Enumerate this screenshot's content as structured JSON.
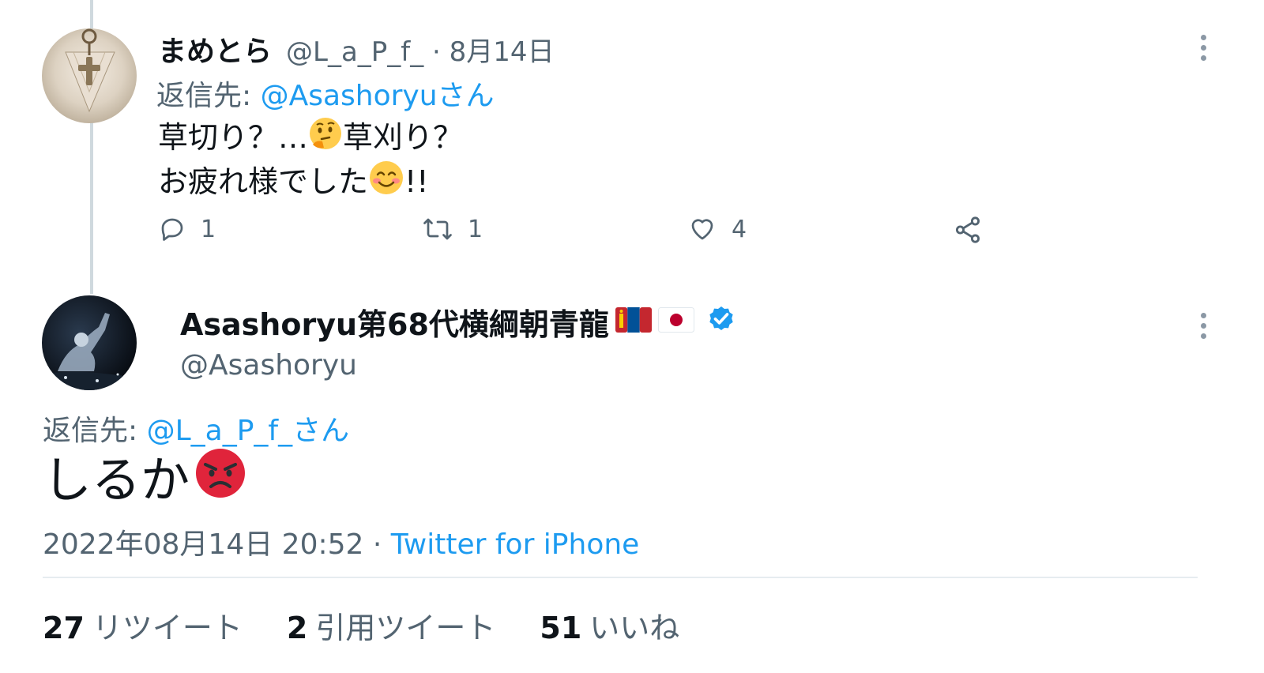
{
  "first_tweet": {
    "display_name": "まめとら",
    "meta": "@L_a_P_f_ · 8月14日",
    "reply_prefix": "返信先: ",
    "reply_mention": "@Asashoryuさん",
    "line1_a": "草切り？…",
    "line1_b": "草刈り？",
    "line2_a": "お疲れ様でした",
    "line2_b": "!!",
    "emoji_thinking": "thinking-face-emoji",
    "emoji_blush": "smiling-face-with-smiling-eyes-emoji",
    "actions": {
      "reply_count": "1",
      "retweet_count": "1",
      "like_count": "4"
    }
  },
  "main_tweet": {
    "display_name": "Asashoryu第68代横綱朝青龍",
    "flags": [
      "mongolia-flag",
      "japan-flag"
    ],
    "verified": true,
    "handle": "@Asashoryu",
    "reply_prefix": "返信先: ",
    "reply_mention": "@L_a_P_f_さん",
    "text": "しるか",
    "emoji": "pouting-face-emoji",
    "timestamp": "2022年08月14日 20:52 · ",
    "source": "Twitter for iPhone"
  },
  "stats": {
    "retweets_count": "27",
    "retweets_label": "リツイート",
    "quotes_count": "2",
    "quotes_label": "引用ツイート",
    "likes_count": "51",
    "likes_label": "いいね"
  },
  "colors": {
    "accent": "#1d9bf0",
    "muted": "#536471",
    "text": "#0f1419",
    "thread_line": "#cfd9de",
    "angry_red": "#e0243b"
  }
}
